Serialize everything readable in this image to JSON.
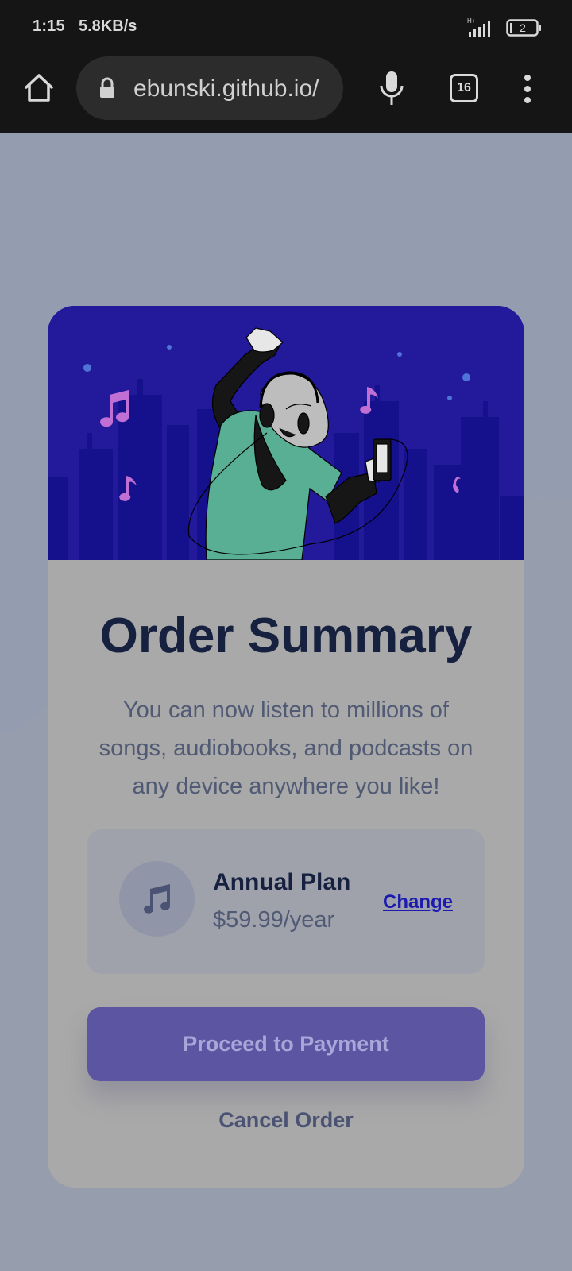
{
  "status_bar": {
    "time": "1:15",
    "network_speed": "5.8KB/s",
    "battery": "2"
  },
  "browser": {
    "url": "ebunski.github.io/",
    "tab_count": "16"
  },
  "card": {
    "title": "Order Summary",
    "description": "You can now listen to millions of songs, audiobooks, and podcasts on any device anywhere you like!",
    "plan": {
      "name": "Annual Plan",
      "price": "$59.99/year",
      "change_label": "Change"
    },
    "proceed_label": "Proceed to Payment",
    "cancel_label": "Cancel Order"
  },
  "colors": {
    "hero_background": "#22199b",
    "primary_button": "#5c56a2",
    "title_text": "#16203f",
    "link": "#1c1bb0"
  },
  "icons": {
    "hero_illustration": "music-listener-illustration",
    "plan_icon": "music-note-icon"
  }
}
